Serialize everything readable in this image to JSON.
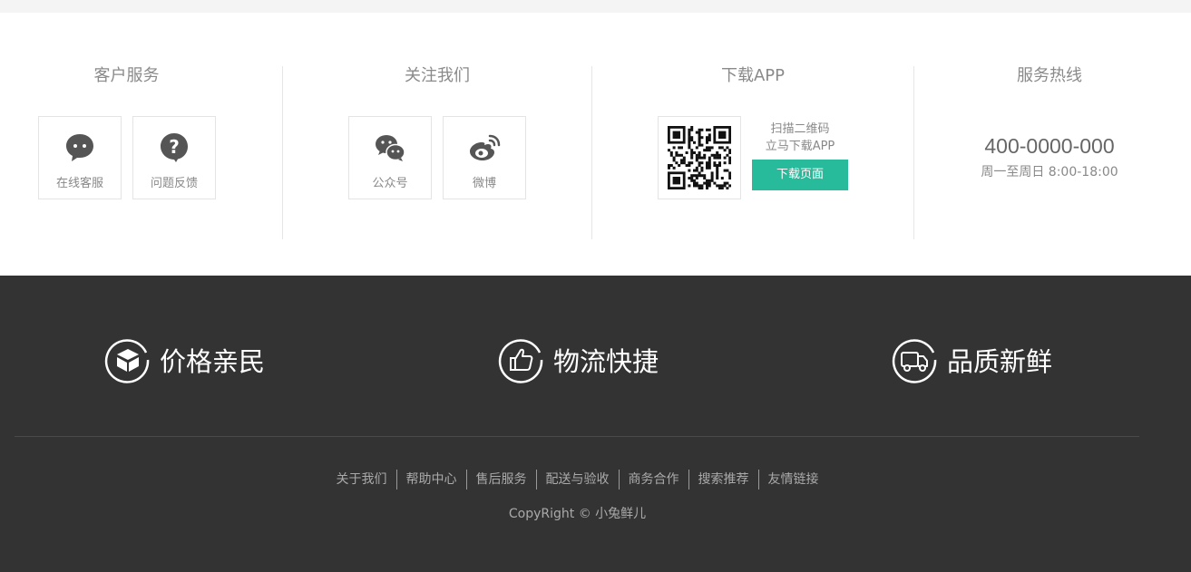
{
  "service": {
    "customer_service": {
      "title": "客户服务",
      "items": [
        {
          "label": "在线客服",
          "icon": "chat-bubble-icon"
        },
        {
          "label": "问题反馈",
          "icon": "question-bubble-icon"
        }
      ]
    },
    "follow_us": {
      "title": "关注我们",
      "items": [
        {
          "label": "公众号",
          "icon": "wechat-icon"
        },
        {
          "label": "微博",
          "icon": "weibo-icon"
        }
      ]
    },
    "download_app": {
      "title": "下载APP",
      "qr_line1": "扫描二维码",
      "qr_line2": "立马下载APP",
      "button": "下载页面",
      "button_color": "#27ba9b"
    },
    "hotline": {
      "title": "服务热线",
      "number": "400-0000-000",
      "hours": "周一至周日 8:00-18:00"
    }
  },
  "promises": [
    {
      "text": "价格亲民",
      "icon": "box-icon"
    },
    {
      "text": "物流快捷",
      "icon": "thumbs-up-icon"
    },
    {
      "text": "品质新鲜",
      "icon": "truck-icon"
    }
  ],
  "footer_links": [
    "关于我们",
    "帮助中心",
    "售后服务",
    "配送与验收",
    "商务合作",
    "搜索推荐",
    "友情链接"
  ],
  "copyright": "CopyRight © 小兔鲜儿",
  "colors": {
    "footer_bg": "#333333",
    "accent": "#27ba9b"
  }
}
